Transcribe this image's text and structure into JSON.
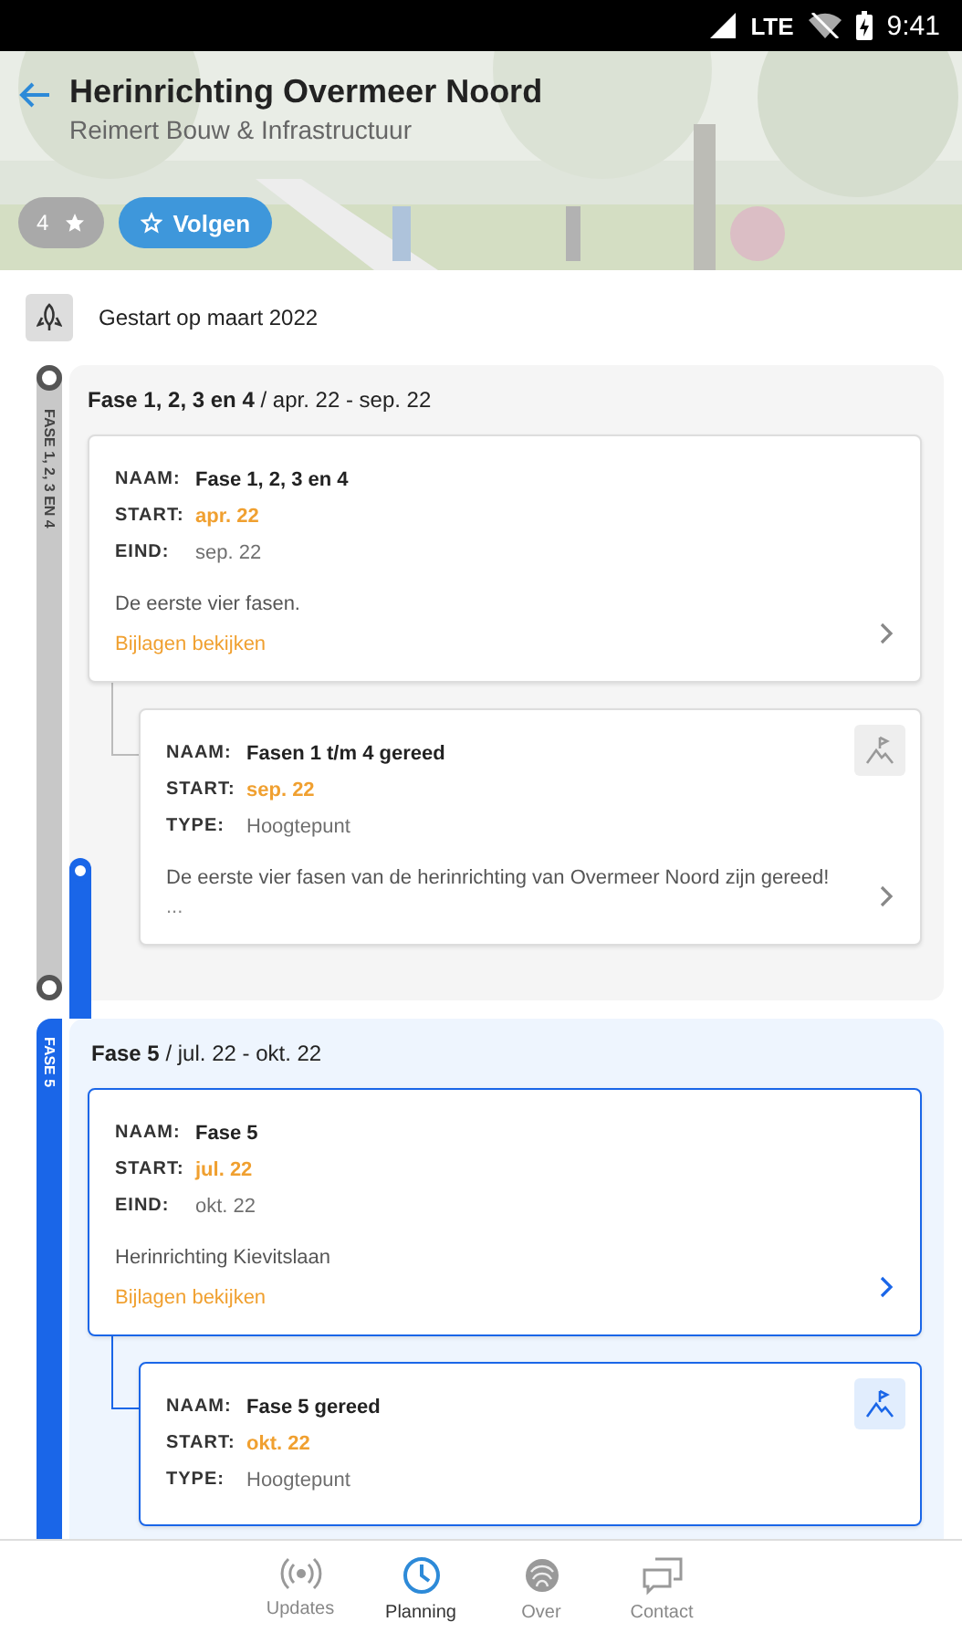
{
  "status_bar": {
    "network": "LTE",
    "time": "9:41"
  },
  "header": {
    "title": "Herinrichting Overmeer Noord",
    "subtitle": "Reimert Bouw & Infrastructuur",
    "rating": "4",
    "follow_label": "Volgen"
  },
  "start_info": "Gestart op maart 2022",
  "phases": [
    {
      "rail_label": "FASE 1, 2, 3 EN 4",
      "title": "Fase 1, 2, 3 en 4",
      "separator": "/",
      "period": "apr. 22 - sep. 22",
      "active": false,
      "cards": [
        {
          "kind": "phase",
          "fields": [
            {
              "kind": "name",
              "label": "NAAM:",
              "value": "Fase 1, 2, 3 en 4"
            },
            {
              "kind": "start",
              "label": "START:",
              "value": "apr. 22"
            },
            {
              "kind": "end",
              "label": "EIND:",
              "value": "sep. 22"
            }
          ],
          "description": "De eerste vier fasen.",
          "link": "Bijlagen bekijken"
        },
        {
          "kind": "milestone",
          "fields": [
            {
              "kind": "name",
              "label": "NAAM:",
              "value": "Fasen 1 t/m 4 gereed"
            },
            {
              "kind": "start",
              "label": "START:",
              "value": "sep. 22"
            },
            {
              "kind": "end",
              "label": "TYPE:",
              "value": "Hoogtepunt"
            }
          ],
          "description": "De eerste vier fasen van de herinrichting van Overmeer Noord zijn gereed!",
          "more": "..."
        }
      ]
    },
    {
      "rail_label": "FASE 5",
      "title": "Fase 5",
      "separator": "/",
      "period": "jul. 22 - okt. 22",
      "active": true,
      "cards": [
        {
          "kind": "phase",
          "fields": [
            {
              "kind": "name",
              "label": "NAAM:",
              "value": "Fase 5"
            },
            {
              "kind": "start",
              "label": "START:",
              "value": "jul. 22"
            },
            {
              "kind": "end",
              "label": "EIND:",
              "value": "okt. 22"
            }
          ],
          "description": "Herinrichting Kievitslaan",
          "link": "Bijlagen bekijken"
        },
        {
          "kind": "milestone",
          "fields": [
            {
              "kind": "name",
              "label": "NAAM:",
              "value": "Fase 5 gereed"
            },
            {
              "kind": "start",
              "label": "START:",
              "value": "okt. 22"
            },
            {
              "kind": "end",
              "label": "TYPE:",
              "value": "Hoogtepunt"
            }
          ]
        }
      ]
    }
  ],
  "nav": [
    {
      "kind": "updates",
      "label": "Updates",
      "selected": false
    },
    {
      "kind": "planning",
      "label": "Planning",
      "selected": true
    },
    {
      "kind": "about",
      "label": "Over",
      "selected": false
    },
    {
      "kind": "contact",
      "label": "Contact",
      "selected": false
    }
  ]
}
